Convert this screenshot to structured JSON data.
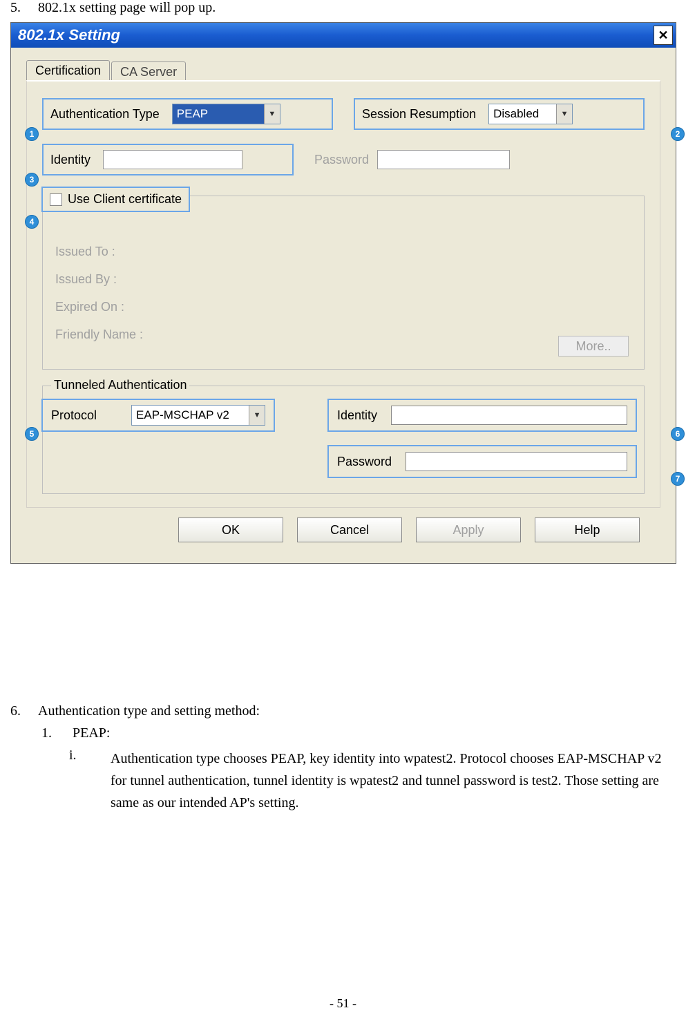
{
  "step5": {
    "num": "5.",
    "text": "802.1x setting page will pop up."
  },
  "dialog": {
    "title": "802.1x Setting",
    "close": "✕",
    "tabs": {
      "certification": "Certification",
      "caserver": "CA Server"
    },
    "auth_type_label": "Authentication Type",
    "auth_type_value": "PEAP",
    "session_label": "Session Resumption",
    "session_value": "Disabled",
    "identity_label": "Identity",
    "password_label": "Password",
    "use_client_cert": "Use Client certificate",
    "cert": {
      "issued_to": "Issued To :",
      "issued_by": "Issued By :",
      "expired_on": "Expired On :",
      "friendly_name": "Friendly Name :",
      "more": "More.."
    },
    "tunnel": {
      "legend": "Tunneled Authentication",
      "protocol_label": "Protocol",
      "protocol_value": "EAP-MSCHAP v2",
      "identity_label": "Identity",
      "password_label": "Password"
    },
    "buttons": {
      "ok": "OK",
      "cancel": "Cancel",
      "apply": "Apply",
      "help": "Help"
    },
    "markers": {
      "m1": "1",
      "m2": "2",
      "m3": "3",
      "m4": "4",
      "m5": "5",
      "m6": "6",
      "m7": "7"
    }
  },
  "step6": {
    "num": "6.",
    "text": "Authentication type and setting method:"
  },
  "sub1": {
    "num": "1.",
    "text": "PEAP:"
  },
  "sub_i": {
    "num": "i.",
    "text": "Authentication type chooses PEAP, key identity into wpatest2. Protocol chooses EAP-MSCHAP v2 for tunnel authentication, tunnel identity is wpatest2 and tunnel password is test2. Those setting are same as our intended AP's setting."
  },
  "pagenum": "- 51 -"
}
